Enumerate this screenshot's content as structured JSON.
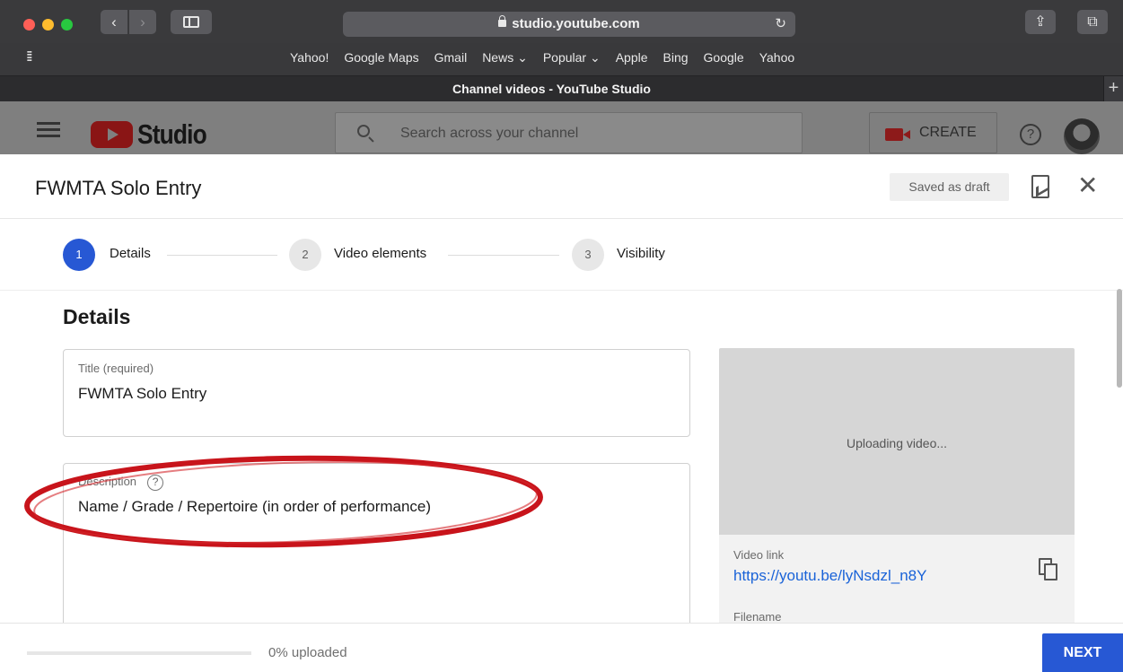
{
  "browser": {
    "url": "studio.youtube.com",
    "tab_title": "Channel videos - YouTube Studio",
    "favorites": [
      "Yahoo!",
      "Google Maps",
      "Gmail",
      "News ⌄",
      "Popular ⌄",
      "Apple",
      "Bing",
      "Google",
      "Yahoo"
    ]
  },
  "studio": {
    "logo_text": "Studio",
    "search_placeholder": "Search across your channel",
    "create_label": "CREATE"
  },
  "dialog": {
    "title": "FWMTA Solo Entry",
    "draft_status": "Saved as draft",
    "steps": [
      {
        "number": "1",
        "label": "Details"
      },
      {
        "number": "2",
        "label": "Video elements"
      },
      {
        "number": "3",
        "label": "Visibility"
      }
    ],
    "section_heading": "Details",
    "title_field": {
      "label": "Title (required)",
      "value": "FWMTA Solo Entry"
    },
    "description_field": {
      "label": "Description",
      "value": "Name / Grade / Repertoire (in order of performance)"
    },
    "preview": {
      "status": "Uploading video...",
      "video_link_label": "Video link",
      "video_link": "https://youtu.be/lyNsdzl_n8Y",
      "filename_label": "Filename"
    },
    "footer": {
      "upload_status": "0% uploaded",
      "upload_progress": 0,
      "next_label": "NEXT"
    }
  },
  "colors": {
    "accent": "#2758d4",
    "link": "#1a63d8",
    "annotation": "#c8141b"
  }
}
